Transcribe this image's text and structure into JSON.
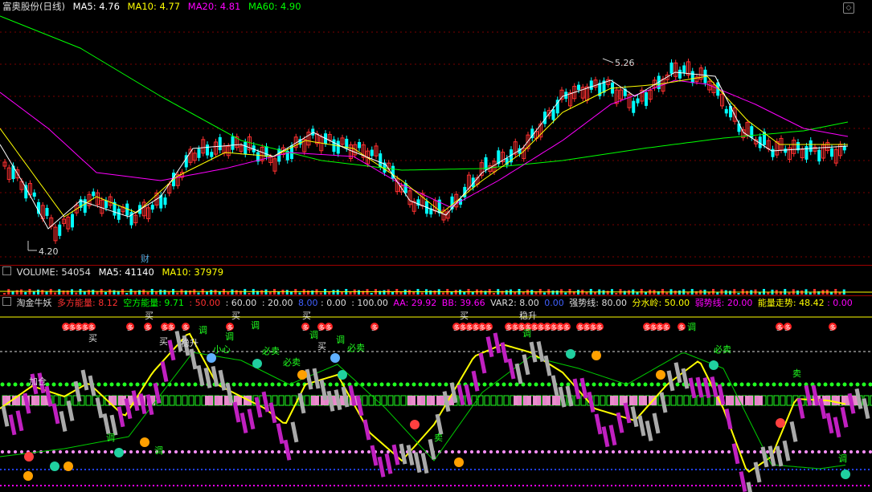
{
  "price_pane": {
    "stock_name": "富奥股份(日线)",
    "ma5": "MA5: 4.76",
    "ma10": "MA10: 4.77",
    "ma20": "MA20: 4.81",
    "ma60": "MA60: 4.90",
    "high_label": "5.26",
    "low_label": "4.20",
    "finance_badge": "财",
    "colors": {
      "ma5": "#ffffff",
      "ma10": "#ffff00",
      "ma20": "#ff00ff",
      "ma60": "#00ff00",
      "up": "#ff3030",
      "down": "#00ffff"
    }
  },
  "volume_pane": {
    "volume": "VOLUME: 54054",
    "ma5": "MA5: 41140",
    "ma10": "MA10: 37979"
  },
  "indicator_pane": {
    "name": "淘金牛妖",
    "duo": "多方能量: 8.12",
    "kong": "空方能量: 9.71",
    "v50": ": 50.00",
    "v60": ": 60.00",
    "v20": ": 20.00",
    "v8": "8.00",
    "v0": ": 0.00",
    "v100": ": 100.00",
    "aa": "AA: 29.92",
    "bb": "BB: 39.66",
    "var2": "VAR2: 8.00",
    "zero": "0.00",
    "strong": "强势线: 80.00",
    "divide": "分水岭: 50.00",
    "weak": "弱势线: 20.00",
    "energy": "能量走势: 48.42",
    "energy_tail": ": 0.00",
    "signal_duo": "多",
    "signal_mai": "买",
    "signal_tiao": "调",
    "signal_wen": "稳升",
    "signal_xiao": "小心",
    "signal_bimai": "必卖",
    "signal_jiacang": "加仓",
    "signal_sell": "卖"
  }
}
